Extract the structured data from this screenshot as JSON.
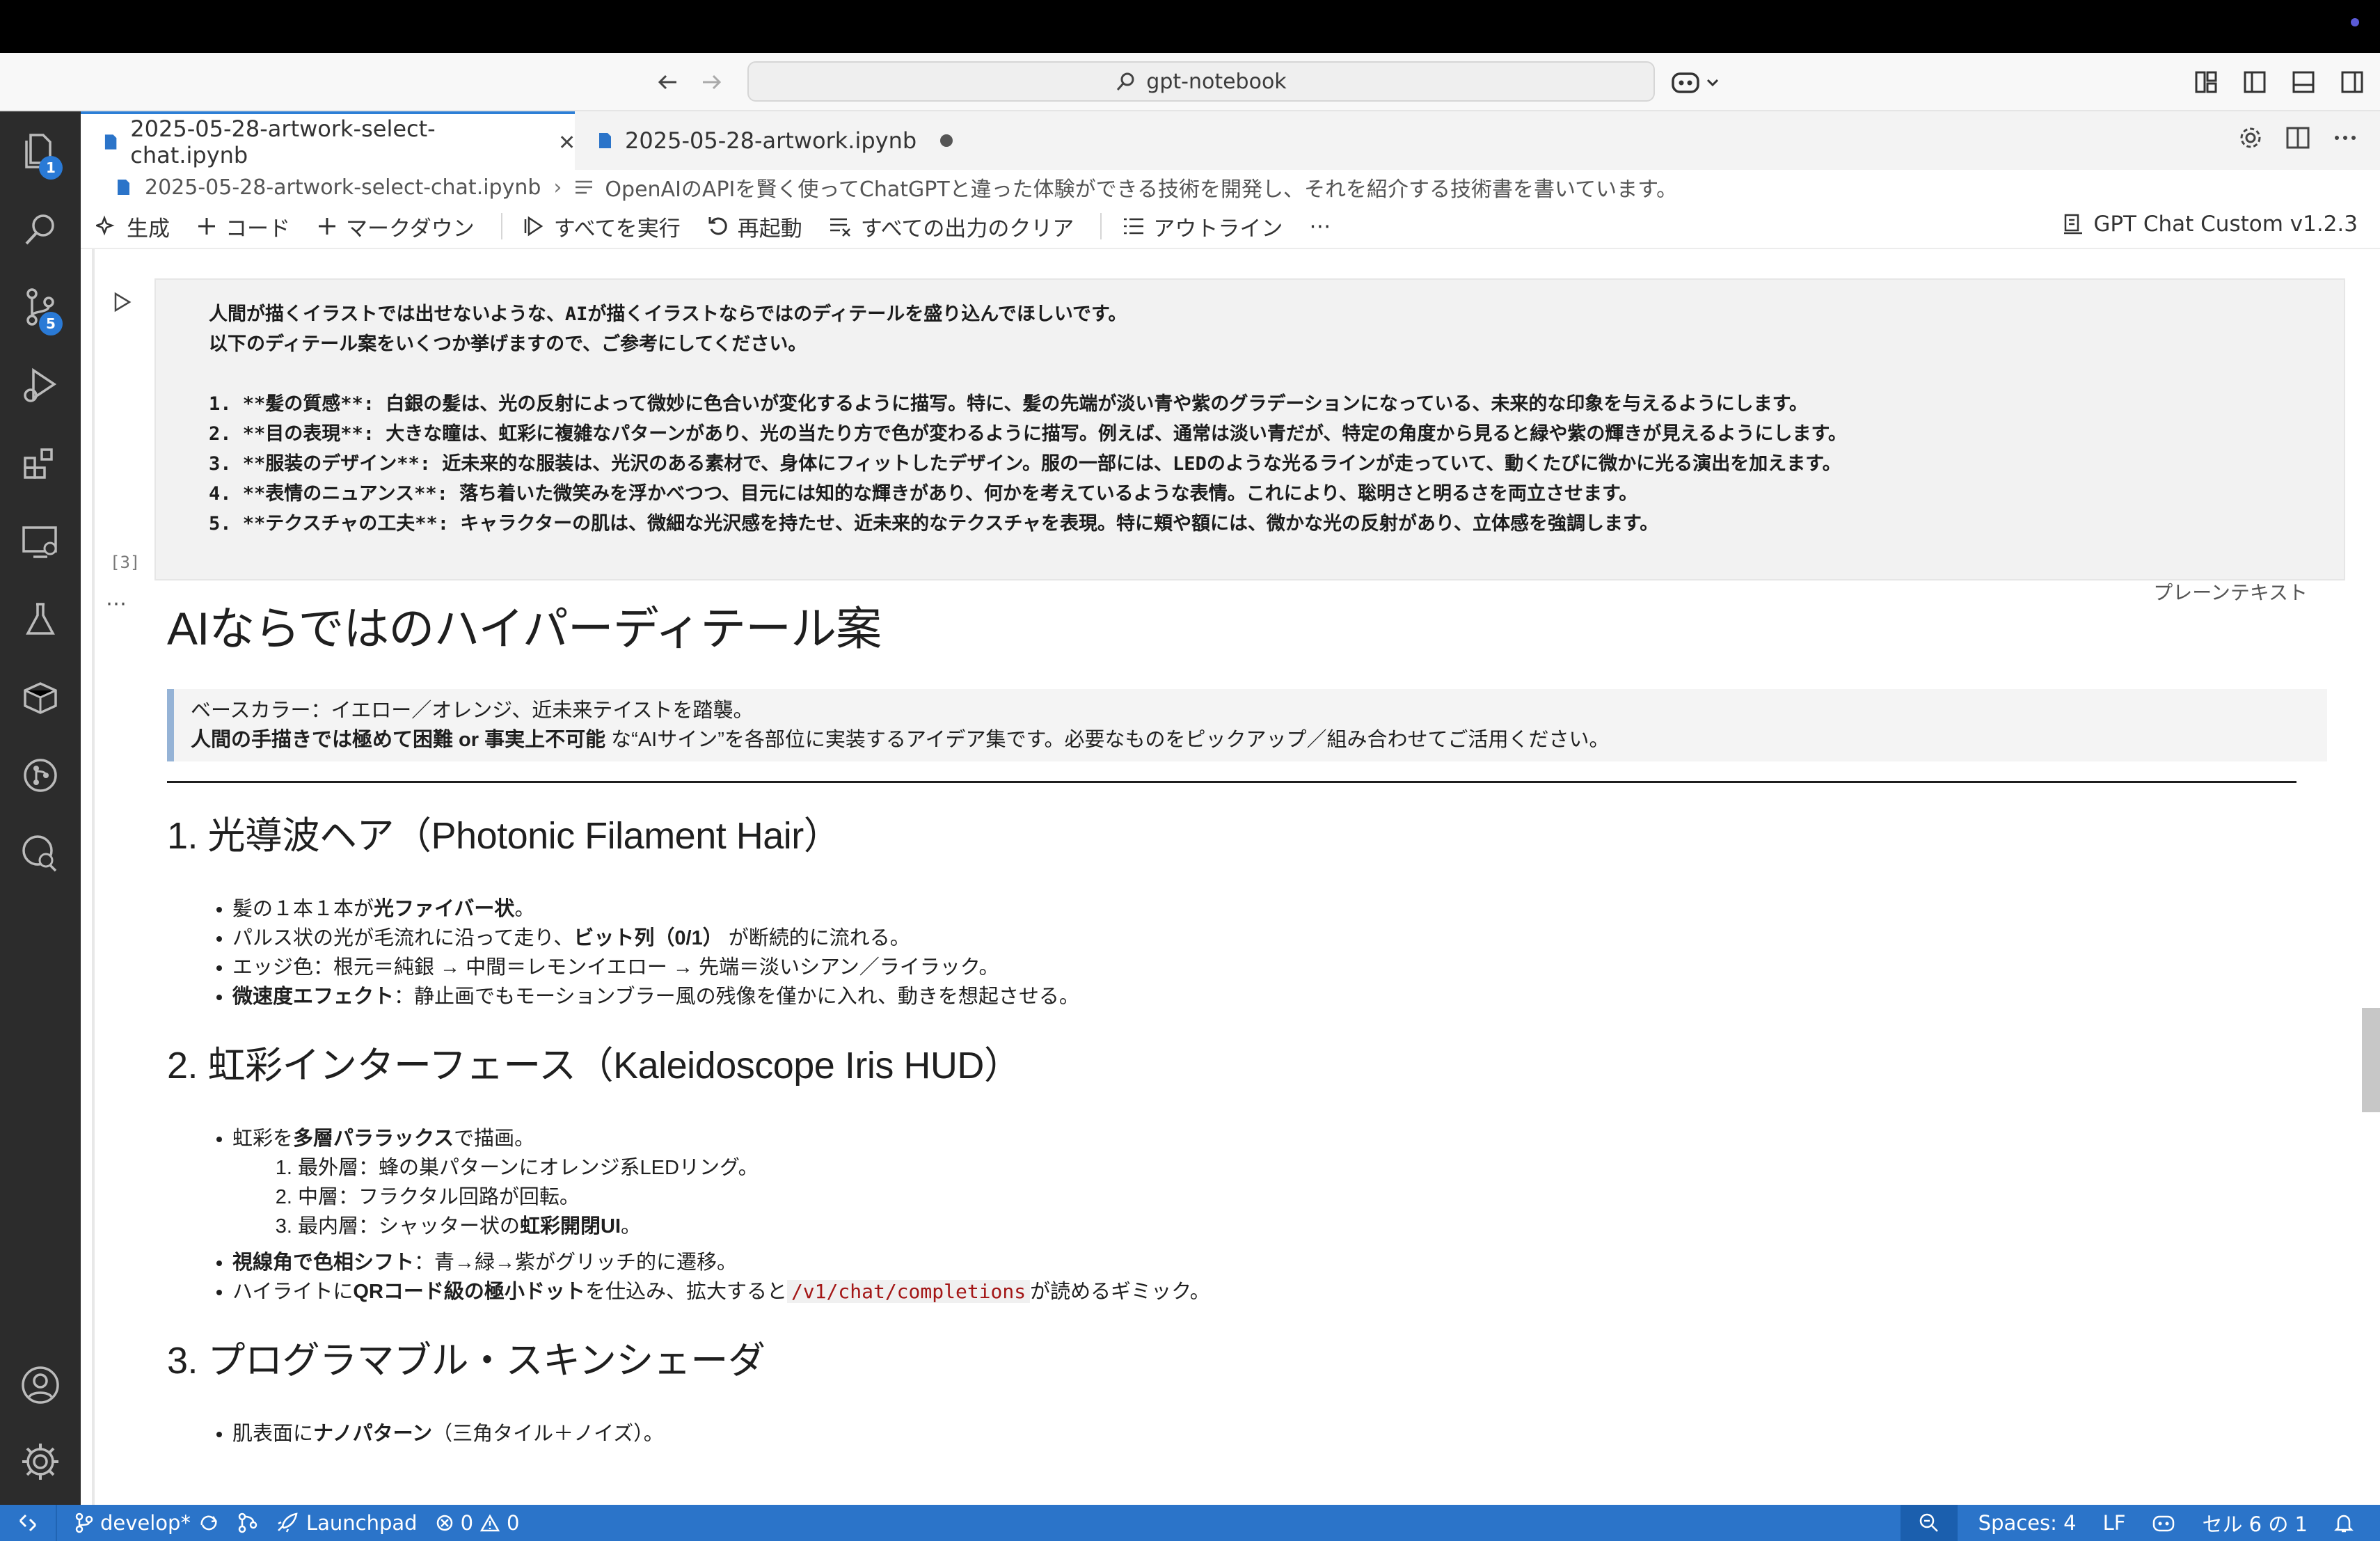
{
  "titlebar": {
    "search_text": "gpt-notebook"
  },
  "activity": {
    "explorer_badge": "1",
    "scm_badge": "5"
  },
  "tabs": [
    {
      "label": "2025-05-28-artwork-select-chat.ipynb"
    },
    {
      "label": "2025-05-28-artwork.ipynb"
    }
  ],
  "breadcrumb": {
    "file": "2025-05-28-artwork-select-chat.ipynb",
    "section": "OpenAIのAPIを賢く使ってChatGPTと違った体験ができる技術を開発し、それを紹介する技術書を書いています。"
  },
  "toolbar": {
    "generate": "生成",
    "code": "コード",
    "markdown": "マークダウン",
    "run_all": "すべてを実行",
    "restart": "再起動",
    "clear_outputs": "すべての出力のクリア",
    "outline": "アウトライン",
    "more": "⋯",
    "kernel": "GPT Chat Custom v1.2.3"
  },
  "output_cell": {
    "lines": [
      "人間が描くイラストでは出せないような、AIが描くイラストならではのディテールを盛り込んでほしいです。",
      "以下のディテール案をいくつか挙げますので、ご参考にしてください。",
      "",
      "1. **髪の質感**: 白銀の髪は、光の反射によって微妙に色合いが変化するように描写。特に、髪の先端が淡い青や紫のグラデーションになっている、未来的な印象を与えるようにします。",
      "2. **目の表現**: 大きな瞳は、虹彩に複雑なパターンがあり、光の当たり方で色が変わるように描写。例えば、通常は淡い青だが、特定の角度から見ると緑や紫の輝きが見えるようにします。",
      "3. **服装のデザイン**: 近未来的な服装は、光沢のある素材で、身体にフィットしたデザイン。服の一部には、LEDのような光るラインが走っていて、動くたびに微かに光る演出を加えます。",
      "4. **表情のニュアンス**: 落ち着いた微笑みを浮かべつつ、目元には知的な輝きがあり、何かを考えているような表情。これにより、聡明さと明るさを両立させます。",
      "5. **テクスチャの工夫**: キャラクターの肌は、微細な光沢感を持たせ、近未来的なテクスチャを表現。特に頬や額には、微かな光の反射があり、立体感を強調します。"
    ],
    "exec_count": "[3]",
    "mime_label": "プレーンテキスト",
    "more": "⋯"
  },
  "markdown": {
    "h1": "AIならではのハイパーディテール案",
    "quote_line1": "ベースカラー：イエロー／オレンジ、近未来テイストを踏襲。",
    "quote_bold": "人間の手描きでは極めて困難 or 事実上不可能",
    "quote_rest": " な“AIサイン”を各部位に実装するアイデア集です。必要なものをピックアップ／組み合わせてご活用ください。",
    "s1": {
      "title": "1. 光導波ヘア（Photonic Filament Hair）",
      "b1_pre": "髪の１本１本が",
      "b1_bold": "光ファイバー状",
      "b1_post": "。",
      "b2_pre": "パルス状の光が毛流れに沿って走り、",
      "b2_bold": "ビット列（0/1）",
      "b2_post": " が断続的に流れる。",
      "b3": "エッジ色：根元＝純銀 → 中間＝レモンイエロー → 先端＝淡いシアン／ライラック。",
      "b4_bold": "微速度エフェクト",
      "b4_post": "：静止画でもモーションブラー風の残像を僅かに入れ、動きを想起させる。"
    },
    "s2": {
      "title": "2. 虹彩インターフェース（Kaleidoscope Iris HUD）",
      "b1_pre": "虹彩を",
      "b1_bold": "多層パララックス",
      "b1_post": "で描画。",
      "o1": "最外層：蜂の巣パターンにオレンジ系LEDリング。",
      "o2": "中層：フラクタル回路が回転。",
      "o3_pre": "最内層：シャッター状の",
      "o3_bold": "虹彩開閉UI",
      "o3_post": "。",
      "b2_bold": "視線角で色相シフト",
      "b2_post": "：青→緑→紫がグリッチ的に遷移。",
      "b3_pre": "ハイライトに",
      "b3_bold": "QRコード級の極小ドット",
      "b3_mid": "を仕込み、拡大すると",
      "b3_code": "/v1/chat/completions",
      "b3_post": "が読めるギミック。"
    },
    "s3": {
      "title": "3. プログラマブル・スキンシェーダ",
      "b1_pre": "肌表面に",
      "b1_bold": "ナノパターン",
      "b1_post": "（三角タイル＋ノイズ）。"
    }
  },
  "statusbar": {
    "branch": "develop*",
    "launchpad": "Launchpad",
    "errors": "0",
    "warnings": "0",
    "spaces": "Spaces: 4",
    "eol": "LF",
    "cell": "セル 6 の 1"
  },
  "colors": {
    "accent": "#2b74c9",
    "activity_bg": "#2c2c2c",
    "badge": "#2a7ad6"
  }
}
